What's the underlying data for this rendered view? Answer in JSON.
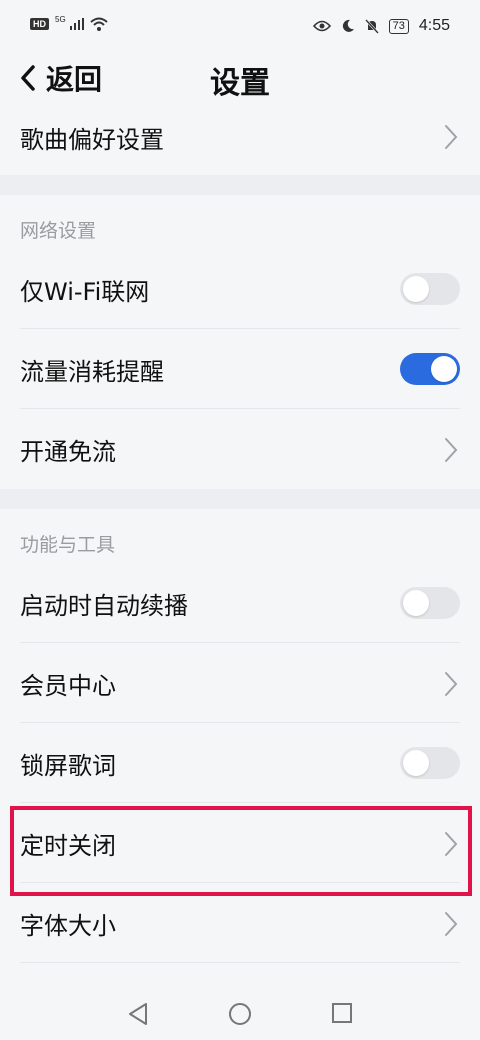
{
  "status_bar": {
    "hd": "HD",
    "network": "5G",
    "battery": "73",
    "time": "4:55"
  },
  "header": {
    "back_label": "返回",
    "title": "设置"
  },
  "rows": {
    "song_pref": "歌曲偏好设置",
    "wifi_only": "仅Wi-Fi联网",
    "data_alert": "流量消耗提醒",
    "free_data": "开通免流",
    "autoplay": "启动时自动续播",
    "vip_center": "会员中心",
    "lock_lyrics": "锁屏歌词",
    "sleep_timer": "定时关闭",
    "font_size": "字体大小"
  },
  "sections": {
    "network": "网络设置",
    "tools": "功能与工具"
  },
  "toggles": {
    "wifi_only": false,
    "data_alert": true,
    "autoplay": false,
    "lock_lyrics": false
  },
  "colors": {
    "accent": "#2b6be0",
    "highlight": "#e0134a"
  }
}
